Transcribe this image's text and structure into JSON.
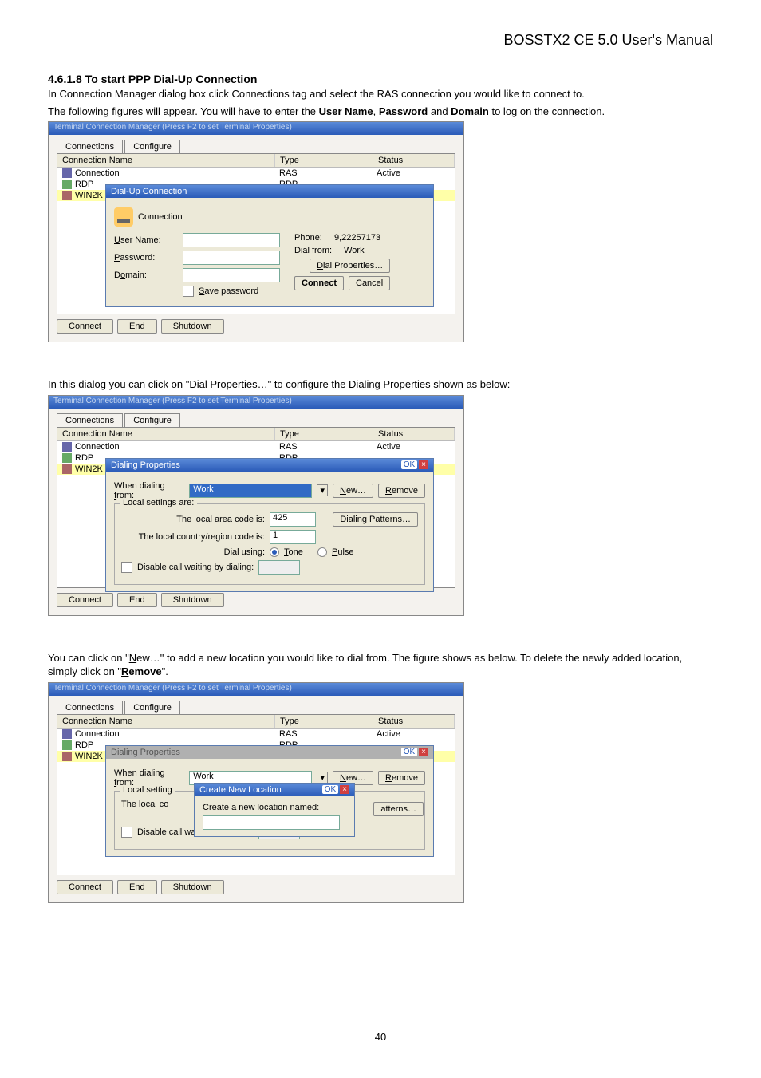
{
  "header": "BOSSTX2 CE 5.0 User's Manual",
  "section_title": "4.6.1.8  To start PPP Dial-Up Connection",
  "para1a": "In Connection Manager dialog box click Connections tag and select the RAS connection you would like to connect to.",
  "para1b_pre": "The following figures will appear. You will have to enter the ",
  "para1b_u": "U",
  "para1b_user": "ser Name",
  "para1b_mid1": ", ",
  "para1b_p": "P",
  "para1b_pass": "assword",
  "para1b_mid2": " and ",
  "para1b_do": "o",
  "para1b_d": "D",
  "para1b_main": "main",
  "para1b_end": " to log on the connection.",
  "para2_pre": "In this dialog you can click on \"",
  "para2_d": "D",
  "para2_ial": "ial Properties…",
  "para2_end": "\" to configure the Dialing Properties shown as below:",
  "para3_pre": "You can click on \"",
  "para3_n": "N",
  "para3_ew": "ew…",
  "para3_mid": "\" to add a new location you would like to dial from. The figure shows as below. To delete the newly added location, simply click on \"",
  "para3_r": "R",
  "para3_emove": "emove",
  "para3_end": "\".",
  "page_num": "40",
  "win": {
    "titlebar": "Terminal Connection Manager (Press F2 to set Terminal Properties)",
    "tab_connections": "Connections",
    "tab_configure": "Configure",
    "col_name": "Connection Name",
    "col_type": "Type",
    "col_status": "Status",
    "row1_name": "Connection",
    "row1_type": "RAS",
    "row1_status": "Active",
    "row2_name": "RDP",
    "row2_type": "RDP",
    "row3_name": "WIN2K",
    "btn_connect": "Connect",
    "btn_end": "End",
    "btn_shutdown": "Shutdown"
  },
  "dialup": {
    "title": "Dial-Up Connection",
    "icon_label": "Connection",
    "user_name": "User Name:",
    "password": "Password:",
    "domain": "Domain:",
    "save_pw": "Save password",
    "phone": "Phone:",
    "phone_val": "9,22257173",
    "dial_from": "Dial from:",
    "dial_from_val": "Work",
    "dial_props": "Dial Properties…",
    "connect": "Connect",
    "cancel": "Cancel"
  },
  "dprops": {
    "title": "Dialing Properties",
    "ok": "OK",
    "when_dialing": "When dialing from:",
    "location": "Work",
    "new": "New…",
    "remove": "Remove",
    "local_settings": "Local settings are:",
    "area_code": "The local area code is:",
    "area_code_val": "425",
    "dialing_patterns": "Dialing Patterns…",
    "country_code": "The local country/region code is:",
    "country_code_val": "1",
    "dial_using": "Dial using:",
    "tone": "Tone",
    "pulse": "Pulse",
    "disable_cw": "Disable call waiting by dialing:"
  },
  "newloc": {
    "title": "Create New Location",
    "prompt": "Create a new location named:",
    "atterns": "atterns…"
  }
}
